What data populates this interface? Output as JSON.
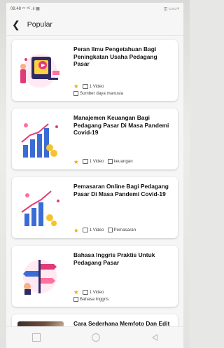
{
  "status": {
    "left": "08.48 ᵛᵒ ⁴ᴳ .ıl ▦",
    "right": "◫ ▭▭+"
  },
  "header": {
    "title": "Popular"
  },
  "items": [
    {
      "title": "Peran Ilmu Pengetahuan Bagi Peningkatan Usaha Pedagang Pasar",
      "videos": "1 Video",
      "category": "Sumber daya manusia"
    },
    {
      "title": "Manajemen Keuangan Bagi Pedagang Pasar Di Masa Pandemi Covid-19",
      "videos": "1 Video",
      "category": "keuangan"
    },
    {
      "title": "Pemasaran Online Bagi Pedagang Pasar Di Masa Pandemi Covid-19",
      "videos": "1 Video",
      "category": "Pemasaran"
    },
    {
      "title": "Bahasa Inggris Praktis Untuk Pedagang Pasar",
      "videos": "1 Video",
      "category": "Bahasa Inggris"
    },
    {
      "title": "Cara Sederhana Memfoto Dan Edit Video"
    }
  ],
  "colors": {
    "star": "#f2a900",
    "accent": "#e23b7a"
  }
}
